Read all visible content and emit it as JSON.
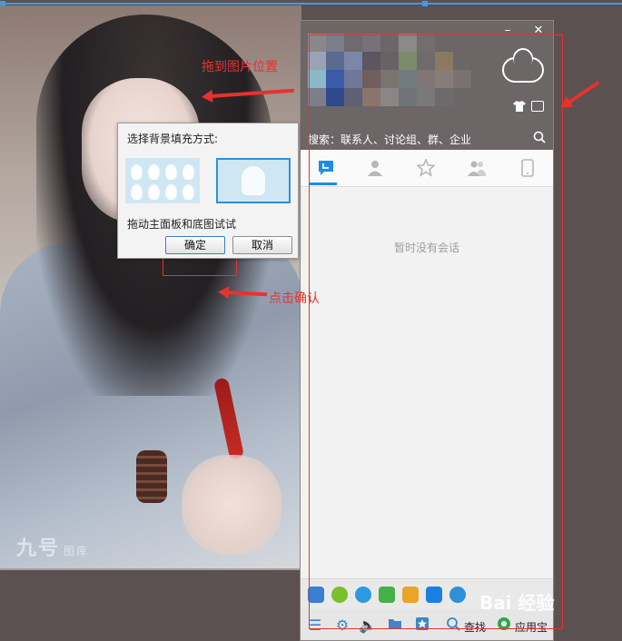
{
  "dialog": {
    "title": "选择背景填充方式:",
    "hint": "拖动主面板和底图试试",
    "ok_label": "确定",
    "cancel_label": "取消"
  },
  "panel": {
    "search_text": "搜索：联系人、讨论组、群、企业",
    "empty_message": "暂时没有会话",
    "tabs": [
      "recent-sessions-icon",
      "contacts-icon",
      "favorites-icon",
      "groups-icon",
      "phone-icon"
    ],
    "bottom_search_label": "查找",
    "bottom_app_label": "应用宝"
  },
  "annotations": {
    "drag_hint": "拖到图片位置",
    "click_hint": "点击确认"
  },
  "photo_watermark": {
    "brand": "九号",
    "sub": "图库"
  },
  "site_watermark": "Bai 经验",
  "colors": {
    "accent": "#1b8fe8",
    "annotation_red": "#e5332f",
    "panel_header": "#6c6667"
  }
}
